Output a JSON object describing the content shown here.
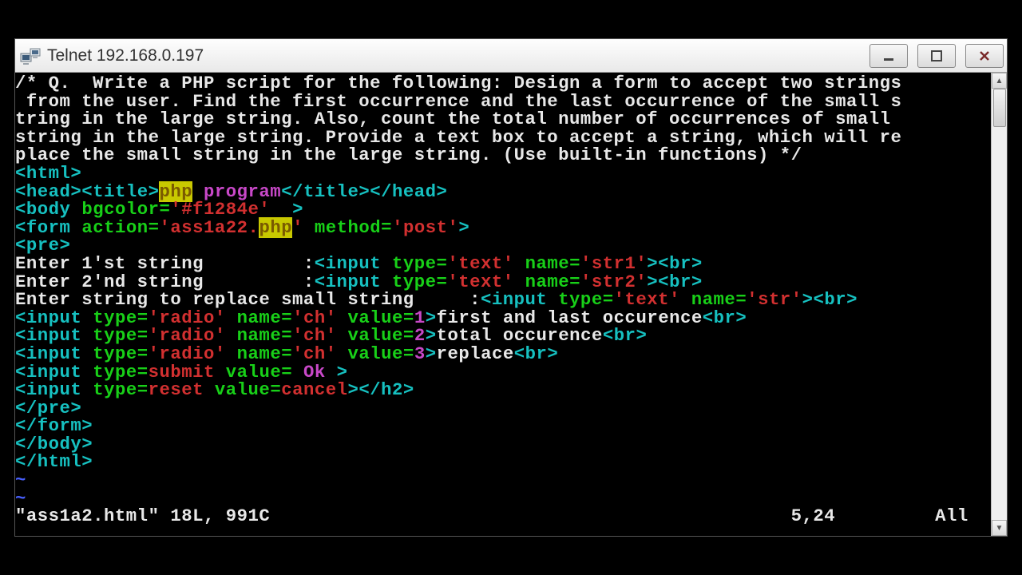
{
  "window": {
    "title": "Telnet 192.168.0.197"
  },
  "terminal": {
    "lines": {
      "comment1": "/* Q.  Write a PHP script for the following: Design a form to accept two strings",
      "comment2": " from the user. Find the first occurrence and the last occurrence of the small s",
      "comment3": "tring in the large string. Also, count the total number of occurrences of small ",
      "comment4": "string in the large string. Provide a text box to accept a string, which will re",
      "comment5": "place the small string in the large string. (Use built-in functions) */",
      "html_open": "html",
      "head": "head",
      "title_tag": "title",
      "php_hl": "php",
      "program": " program",
      "body_tag": "body",
      "bgcolor": "bgcolor",
      "bgcolor_val": "'#f1284e'",
      "form": "form",
      "action": "action",
      "action_val": "'ass1a22.",
      "action_val2": "'",
      "method": "method",
      "method_val": "'post'",
      "pre": "pre",
      "enter1": "Enter 1'st string         :",
      "enter2": "Enter 2'nd string         :",
      "enter3": "Enter string to replace small string     :",
      "input": "input",
      "type": "type",
      "text": "'text'",
      "name": "name",
      "str1": "'str1'",
      "str2": "'str2'",
      "str": "'str'",
      "br": "br",
      "radio": "'radio'",
      "ch": "'ch'",
      "value": "value",
      "v1": "1",
      "v2": "2",
      "v3": "3",
      "opt1": "first and last occurence",
      "opt2": "total occurence",
      "opt3": "replace",
      "submit": "submit",
      "ok": "Ok",
      "reset": "reset",
      "cancel": "cancel",
      "h2c": "h2",
      "tilde": "~"
    },
    "status": {
      "file": "\"ass1a2.html\" 18L, 991C",
      "pos": "5,24",
      "all": "All"
    }
  }
}
